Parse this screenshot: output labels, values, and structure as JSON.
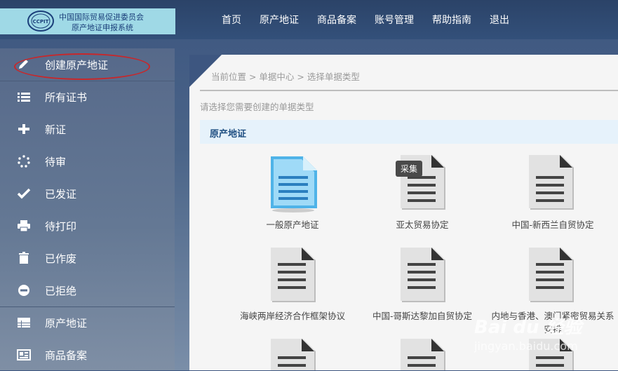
{
  "logo": {
    "emblem_text": "CCPIT",
    "line1": "中国国际贸易促进委员会",
    "line2": "原产地证申报系统"
  },
  "topnav": [
    "首页",
    "原产地证",
    "商品备案",
    "账号管理",
    "帮助指南",
    "退出"
  ],
  "sidebar": {
    "items": [
      {
        "label": "创建原产地证",
        "icon": "pencil-icon"
      },
      {
        "label": "所有证书",
        "icon": "list-icon"
      },
      {
        "label": "新证",
        "icon": "plus-icon"
      },
      {
        "label": "待审",
        "icon": "spinner-icon"
      },
      {
        "label": "已发证",
        "icon": "check-icon"
      },
      {
        "label": "待打印",
        "icon": "printer-icon"
      },
      {
        "label": "已作废",
        "icon": "trash-icon"
      },
      {
        "label": "已拒绝",
        "icon": "minus-circle-icon"
      },
      {
        "label": "原产地证",
        "icon": "table-icon"
      },
      {
        "label": "商品备案",
        "icon": "newspaper-icon"
      }
    ]
  },
  "breadcrumb": "当前位置 > 单据中心 > 选择单据类型",
  "hint": "请选择您需要创建的单据类型",
  "section_title": "原产地证",
  "documents": [
    {
      "name": "一般原产地证",
      "style": "blue"
    },
    {
      "name": "亚太贸易协定",
      "style": "gray"
    },
    {
      "name": "中国-新西兰自贸协定",
      "style": "gray"
    },
    {
      "name": "海峡两岸经济合作框架协议",
      "style": "gray"
    },
    {
      "name": "中国-哥斯达黎加自贸协定",
      "style": "gray"
    },
    {
      "name": "内地与香港、澳门紧密贸易关系安排",
      "style": "gray"
    }
  ],
  "tooltip": "采集",
  "watermark": {
    "main": "Bai du 经验",
    "sub": "jingyan.baidu.com"
  },
  "colors": {
    "highlight_oval": "#c8272a",
    "header": "#2b4368",
    "section_title": "#1f4f82"
  }
}
